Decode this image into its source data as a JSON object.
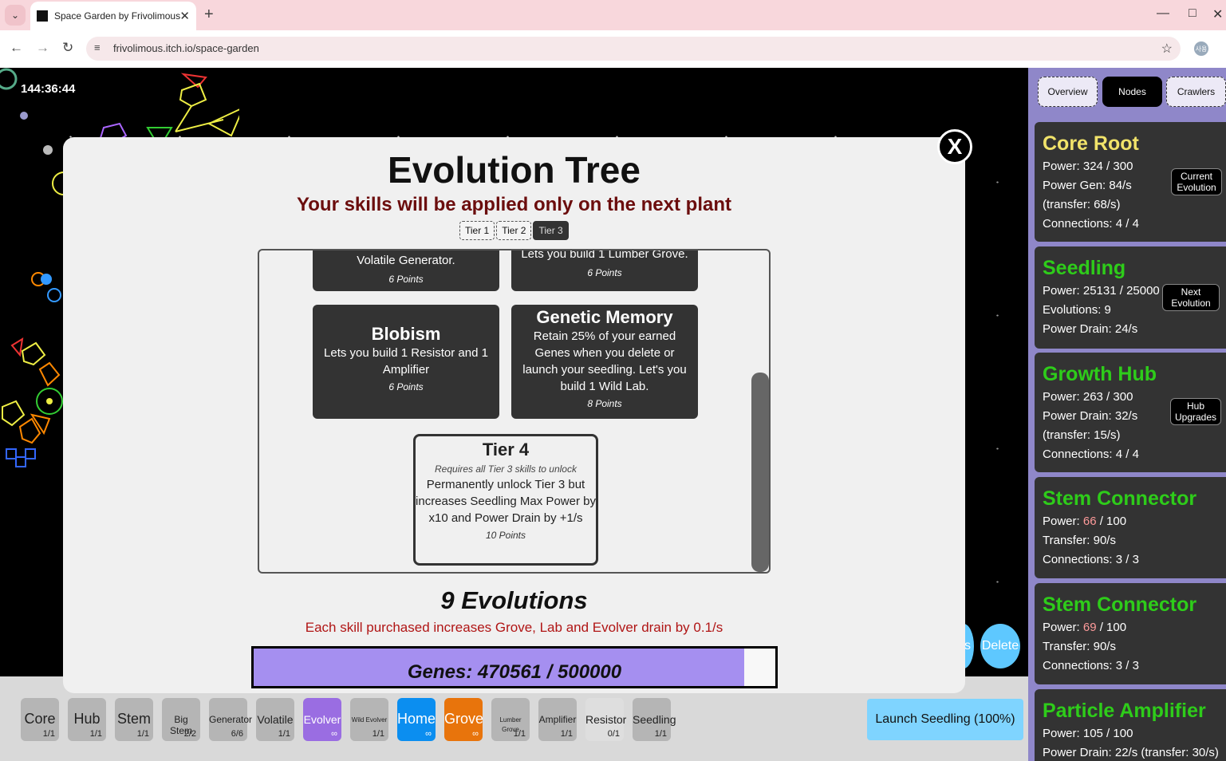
{
  "browser": {
    "tab_title": "Space Garden by Frivolimous",
    "url": "frivolimous.itch.io/space-garden",
    "profile_label": "사용",
    "icons": [
      "chevron-down-icon",
      "favicon",
      "close-icon",
      "plus-icon",
      "minimize-icon",
      "maximize-icon",
      "close-window-icon",
      "back-icon",
      "forward-icon",
      "reload-icon",
      "site-info-icon",
      "star-icon"
    ]
  },
  "game": {
    "timer": "144:36:44",
    "delete_label": "Delete",
    "partial_label": "s",
    "launch_label": "Launch Seedling (100%)",
    "toolbar": [
      {
        "name": "Core",
        "count": "1/1",
        "color": "#b5b5b5",
        "size": "lg"
      },
      {
        "name": "Hub",
        "count": "1/1",
        "color": "#b5b5b5",
        "size": "lg"
      },
      {
        "name": "Stem",
        "count": "1/1",
        "color": "#b5b5b5",
        "size": "lg"
      },
      {
        "name": "Big Stem",
        "count": "2/2",
        "color": "#b5b5b5",
        "size": "sm"
      },
      {
        "name": "Generator",
        "count": "6/6",
        "color": "#b5b5b5",
        "size": "sm"
      },
      {
        "name": "Volatile",
        "count": "1/1",
        "color": "#b5b5b5",
        "size": "md"
      },
      {
        "name": "Evolver",
        "count": "∞",
        "color": "#9a6de2",
        "size": "md"
      },
      {
        "name": "Wild Evolver",
        "count": "1/1",
        "color": "#b5b5b5",
        "size": "xs"
      },
      {
        "name": "Home",
        "count": "∞",
        "color": "#0b8ef0",
        "size": "lg"
      },
      {
        "name": "Grove",
        "count": "∞",
        "color": "#e8740c",
        "size": "lg"
      },
      {
        "name": "Lumber Grove",
        "count": "1/1",
        "color": "#b5b5b5",
        "size": "xs"
      },
      {
        "name": "Amplifier",
        "count": "1/1",
        "color": "#b5b5b5",
        "size": "sm"
      },
      {
        "name": "Resistor",
        "count": "0/1",
        "color": "#dedede",
        "size": "md"
      },
      {
        "name": "Seedling",
        "count": "1/1",
        "color": "#b5b5b5",
        "size": "md"
      }
    ]
  },
  "modal": {
    "title": "Evolution Tree",
    "subtitle": "Your skills will be applied only on the next plant",
    "tiers": [
      "Tier 1",
      "Tier 2",
      "Tier 3"
    ],
    "active_tier": "Tier 3",
    "close_label": "X",
    "cards": [
      {
        "title": "",
        "desc": "Volatile Generator.",
        "points": "6 Points"
      },
      {
        "title": "",
        "desc": "Lets you build 1 Lumber Grove.",
        "points": "6 Points"
      },
      {
        "title": "Blobism",
        "desc": "Lets you build 1 Resistor and 1 Amplifier",
        "points": "6 Points"
      },
      {
        "title": "Genetic Memory",
        "desc": "Retain 25% of your earned Genes when you delete or launch your seedling. Let's you build 1 Wild Lab.",
        "points": "8 Points"
      }
    ],
    "tier4": {
      "title": "Tier 4",
      "requirement": "Requires all Tier 3 skills to unlock",
      "desc": "Permanently unlock Tier 3 but increases Seedling Max Power by x10 and Power Drain by +1/s",
      "points": "10 Points"
    },
    "evolutions": "9 Evolutions",
    "note": "Each skill purchased increases Grove, Lab and Evolver drain by 0.1/s",
    "genes": {
      "label": "Genes: 470561 / 500000",
      "current": 470561,
      "max": 500000
    }
  },
  "panel": {
    "tabs": [
      "Overview",
      "Nodes",
      "Crawlers"
    ],
    "active_tab": "Nodes",
    "nodes": [
      {
        "name": "Core Root",
        "color": "#f1e36a",
        "lines": [
          "Power: 324 / 300",
          "Power Gen: 84/s",
          "(transfer: 68/s)",
          "Connections: 4 / 4"
        ],
        "button": "Current Evolution"
      },
      {
        "name": "Seedling",
        "color": "#2ecc1a",
        "lines": [
          "Power: 25131 / 25000",
          "Evolutions: 9",
          "Power Drain: 24/s"
        ],
        "button": "Next Evolution"
      },
      {
        "name": "Growth Hub",
        "color": "#2ecc1a",
        "lines": [
          "Power: 263 / 300",
          "Power Drain: 32/s",
          "(transfer: 15/s)",
          "Connections: 4 / 4"
        ],
        "button": "Hub Upgrades"
      },
      {
        "name": "Stem Connector",
        "color": "#2ecc1a",
        "power_label": "Power: ",
        "power_value": "66",
        "power_max": " / 100",
        "lines": [
          "Transfer: 90/s",
          "Connections: 3 / 3"
        ]
      },
      {
        "name": "Stem Connector",
        "color": "#2ecc1a",
        "power_label": "Power: ",
        "power_value": "69",
        "power_max": " / 100",
        "lines": [
          "Transfer: 90/s",
          "Connections: 3 / 3"
        ]
      },
      {
        "name": "Particle Amplifier",
        "color": "#2ecc1a",
        "lines": [
          "Power: 105 / 100",
          "Power Drain: 22/s (transfer: 30/s)"
        ]
      }
    ]
  }
}
